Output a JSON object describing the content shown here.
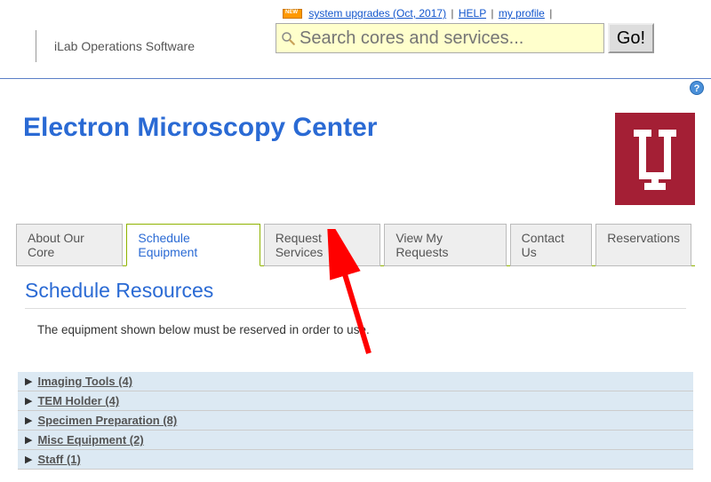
{
  "brand": "iLab Operations Software",
  "top_links": {
    "upgrades": "system upgrades (Oct, 2017)",
    "help": "HELP",
    "profile": "my profile"
  },
  "search": {
    "placeholder": "Search cores and services...",
    "go": "Go!"
  },
  "page_title": "Electron Microscopy Center",
  "help_glyph": "?",
  "tabs": {
    "about": "About Our Core",
    "schedule": "Schedule Equipment",
    "request": "Request Services",
    "view": "View My Requests",
    "contact": "Contact Us",
    "reservations": "Reservations"
  },
  "section": {
    "title": "Schedule Resources",
    "blurb": "The equipment shown below must be reserved in order to use."
  },
  "categories": [
    "Imaging Tools (4)",
    "TEM Holder (4)",
    "Specimen Preparation (8)",
    "Misc Equipment (2)",
    "Staff (1)"
  ]
}
